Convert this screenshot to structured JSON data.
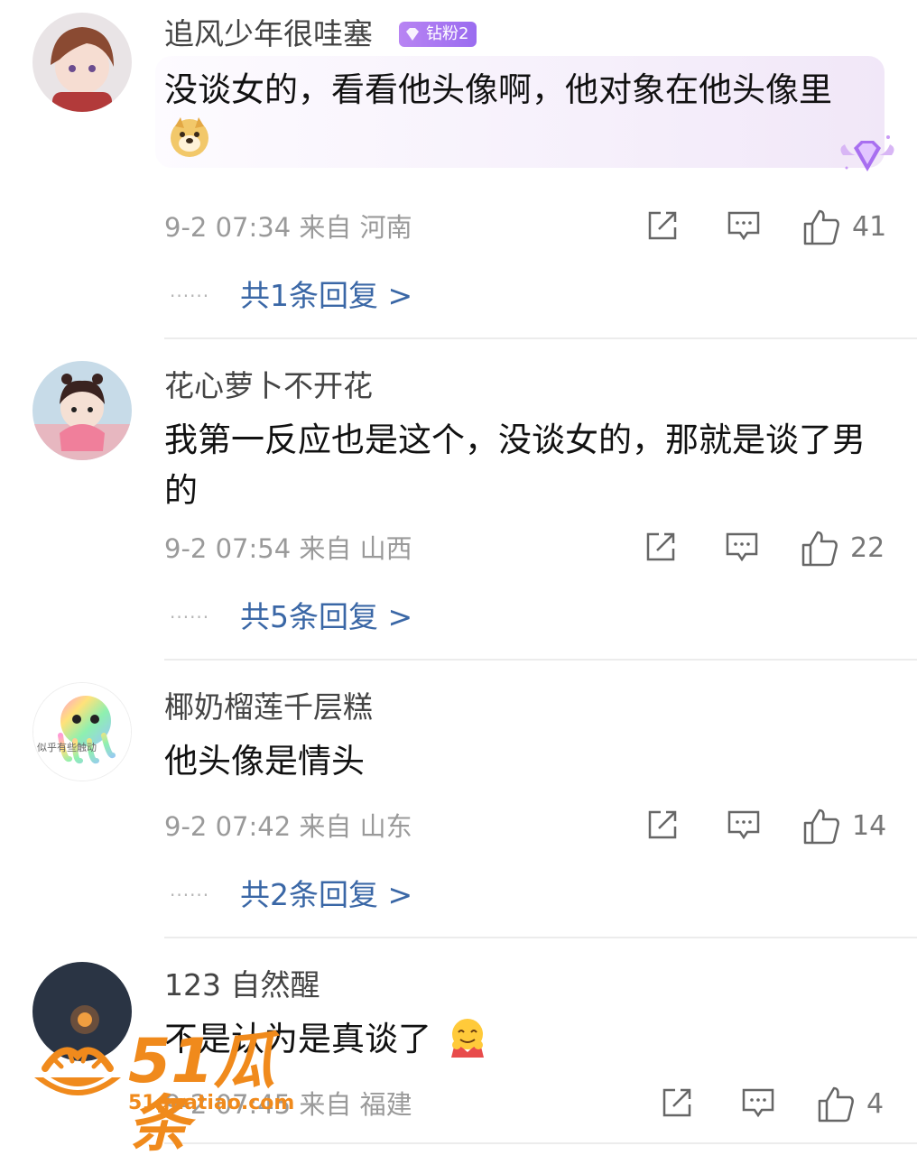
{
  "icons": {
    "share": "share-icon",
    "comment": "comment-icon",
    "like": "thumbs-up-icon"
  },
  "colors": {
    "reply_link": "#3a67a6",
    "badge": "#9a6cf0",
    "watermark": "#f08a1c"
  },
  "comments": [
    {
      "username": "追风少年很哇塞",
      "badge": "钻粉2",
      "text": "没谈女的，看看他头像啊，他对象在他头像里",
      "emoji": "doge-emoji",
      "meta": "9-2 07:34 来自 河南",
      "likes": "41",
      "replies": "共1条回复 >",
      "dots": "······"
    },
    {
      "username": "花心萝卜不开花",
      "text": "我第一反应也是这个，没谈女的，那就是谈了男的",
      "meta": "9-2 07:54 来自 山西",
      "likes": "22",
      "replies": "共5条回复 >",
      "dots": "······"
    },
    {
      "username": "椰奶榴莲千层糕",
      "avatar_text": "似乎有些触动",
      "text": "他头像是情头",
      "meta": "9-2 07:42 来自 山东",
      "likes": "14",
      "replies": "共2条回复 >",
      "dots": "······"
    },
    {
      "username": "123 自然醒",
      "text": "不是认为是真谈了",
      "emoji": "hug-emoji",
      "meta": "9-2 07:45 来自 福建",
      "likes": "4"
    }
  ],
  "watermark": {
    "logo_text": "51瓜条",
    "url": "51guatiao.com"
  }
}
